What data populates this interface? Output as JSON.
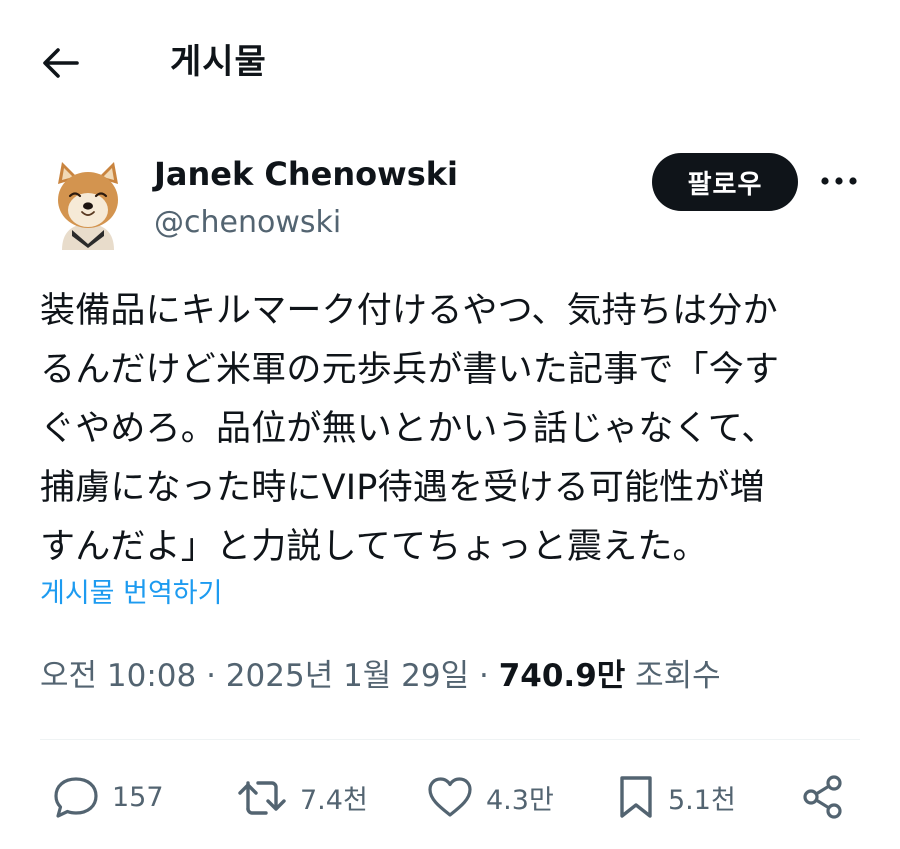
{
  "header": {
    "title": "게시물"
  },
  "author": {
    "display_name": "Janek Chenowski",
    "handle": "@chenowski",
    "avatar_icon": "dog-avatar-icon"
  },
  "follow_label": "팔로우",
  "tweet": {
    "lines": [
      "装備品にキルマーク付けるやつ、気持ちは分か",
      "るんだけど米軍の元歩兵が書いた記事で「今す",
      "ぐやめろ。品位が無いとかいう話じゃなくて、",
      "捕虜になった時にVIP待遇を受ける可能性が増",
      "すんだよ」と力説しててちょっと震えた。"
    ],
    "translate_label": "게시물 번역하기"
  },
  "meta": {
    "time": "오전 10:08",
    "separator": " · ",
    "date": "2025년 1월 29일",
    "views_count": "740.9만",
    "views_label": "조회수"
  },
  "actions": {
    "reply_count": "157",
    "repost_count": "7.4천",
    "like_count": "4.3만",
    "bookmark_count": "5.1천"
  },
  "colors": {
    "text": "#0f1419",
    "secondary": "#536471",
    "link": "#1d9bf0",
    "button_bg": "#0f1419"
  }
}
